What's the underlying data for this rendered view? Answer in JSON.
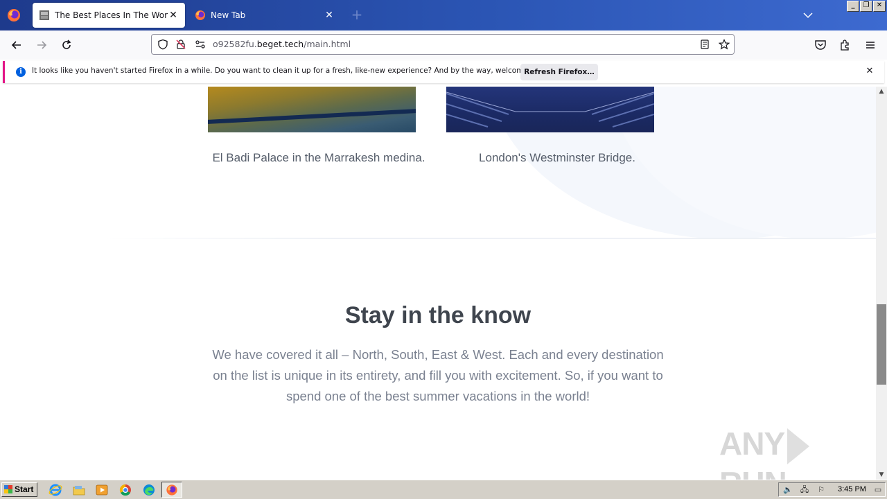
{
  "browser": {
    "tabs": [
      {
        "title": "The Best Places In The World",
        "active": true
      },
      {
        "title": "New Tab",
        "active": false
      }
    ],
    "url": {
      "prefix": "o92582fu.",
      "domain": "beget.tech",
      "path": "/main.html"
    },
    "window_controls": {
      "minimize": "_",
      "maximize": "❐",
      "close": "✕"
    }
  },
  "notification": {
    "message": "It looks like you haven't started Firefox in a while. Do you want to clean it up for a fresh, like-new experience? And by the way, welcome back!",
    "button_label": "Refresh Firefox…",
    "close": "✕"
  },
  "gallery": [
    {
      "caption": "El Badi Palace in the Marrakesh medina."
    },
    {
      "caption": "London's Westminster Bridge."
    }
  ],
  "section": {
    "title": "Stay in the know",
    "text": "We have covered it all – North, South, East & West. Each and every destination on the list is unique in its entirety, and fill you with excitement. So, if you want to spend one of the best summer vacations in the world!"
  },
  "watermark": {
    "left": "ANY",
    "right": "RUN"
  },
  "taskbar": {
    "start_label": "Start",
    "clock": "3:45 PM"
  },
  "scrollbar": {
    "position_fraction": 0.71
  },
  "colors": {
    "tabstrip": "#2b55b4",
    "notification_accent": "#e31587",
    "info_icon": "#0060df"
  }
}
